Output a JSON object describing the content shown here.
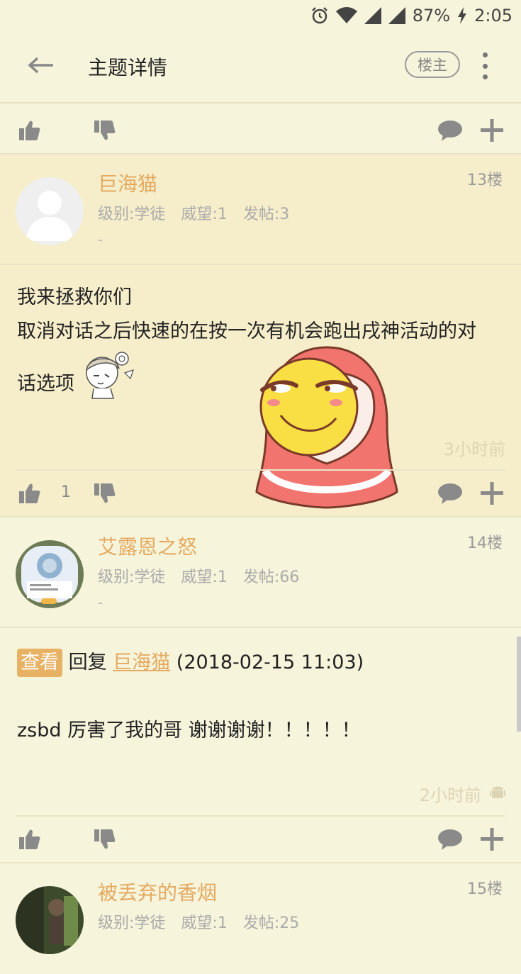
{
  "status_bar": {
    "battery": "87%",
    "time": "2:05"
  },
  "header": {
    "title": "主题详情",
    "owner_button": "楼主"
  },
  "posts": [
    {
      "floor": "13楼",
      "username": "巨海猫",
      "level": "级别:学徒",
      "prestige": "威望:1",
      "posts_count": "发帖:3",
      "signature": "-",
      "lines": [
        "我来拯救你们",
        "取消对话之后快速的在按一次有机会跑出戌神活动的对",
        "话选项"
      ],
      "time": "3小时前",
      "likes": "1"
    },
    {
      "floor": "14楼",
      "username": "艾露恩之怒",
      "level": "级别:学徒",
      "prestige": "威望:1",
      "posts_count": "发帖:66",
      "signature": "-",
      "reply_tag": "查看",
      "reply_word": "回复",
      "reply_user": "巨海猫",
      "reply_date": "(2018-02-15 11:03)",
      "content": "zsbd 厉害了我的哥 谢谢谢谢！！！！！",
      "time": "2小时前"
    },
    {
      "floor": "15楼",
      "username": "被丢弃的香烟",
      "level": "级别:学徒",
      "prestige": "威望:1",
      "posts_count": "发帖:25"
    }
  ],
  "icons": {
    "back": "arrow-left-icon",
    "more": "more-vert-icon",
    "thumb_up": "thumb-up-icon",
    "thumb_down": "thumb-down-icon",
    "comment": "comment-icon",
    "add": "plus-icon",
    "android": "android-icon"
  },
  "colors": {
    "background": "#f7f4dc",
    "highlight": "#f6eecb",
    "username": "#e4aa60",
    "tag": "#e8b264"
  }
}
